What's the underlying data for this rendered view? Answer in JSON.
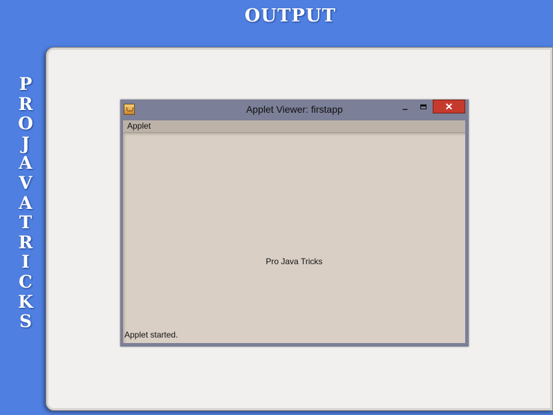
{
  "slide": {
    "title": "OUTPUT",
    "side_letters": [
      "P",
      "R",
      "O",
      "J",
      "A",
      "V",
      "A",
      "T",
      "R",
      "I",
      "C",
      "K",
      "S"
    ]
  },
  "window": {
    "title": "Applet Viewer: firstapp",
    "minimize_label": "–",
    "close_label": "✕",
    "menu": {
      "applet_label": "Applet"
    },
    "content_text": "Pro Java Tricks",
    "status_text": "Applet started.",
    "icons": {
      "app": "java-cup-icon",
      "minimize": "minimize-icon",
      "maximize": "maximize-icon",
      "close": "close-icon"
    }
  },
  "colors": {
    "background": "#4f7fe0",
    "panel": "#f2f0ee",
    "applet_area": "#d9cfc5",
    "close_button": "#c63a2e"
  }
}
